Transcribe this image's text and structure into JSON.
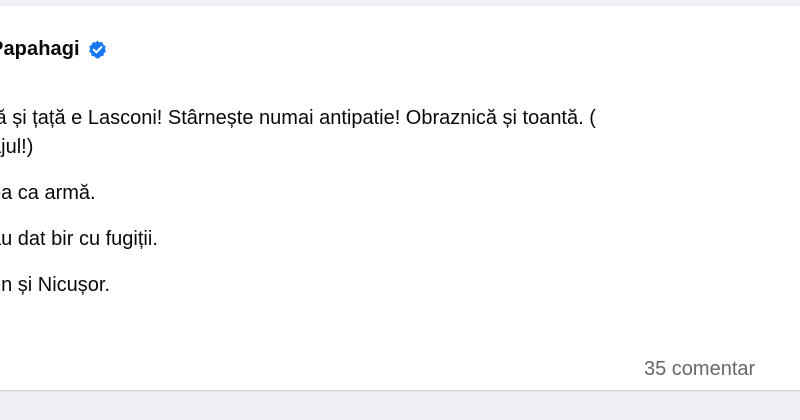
{
  "post": {
    "author_name": "Papahagi",
    "icons": {
      "verified": "verified-badge-icon"
    },
    "colors": {
      "verified": "#1877f2",
      "secondary_text": "#65676b"
    },
    "paragraphs": [
      [
        "tă și țață e Lasconi! Stârnește numai antipatie! Obraznică și toantă. (",
        "ajul!)"
      ],
      [
        "ea ca armă."
      ],
      [
        " au dat bir cu fugiții."
      ],
      [
        "rin și Nicușor."
      ]
    ],
    "comments_count_text": "35 comentar"
  }
}
